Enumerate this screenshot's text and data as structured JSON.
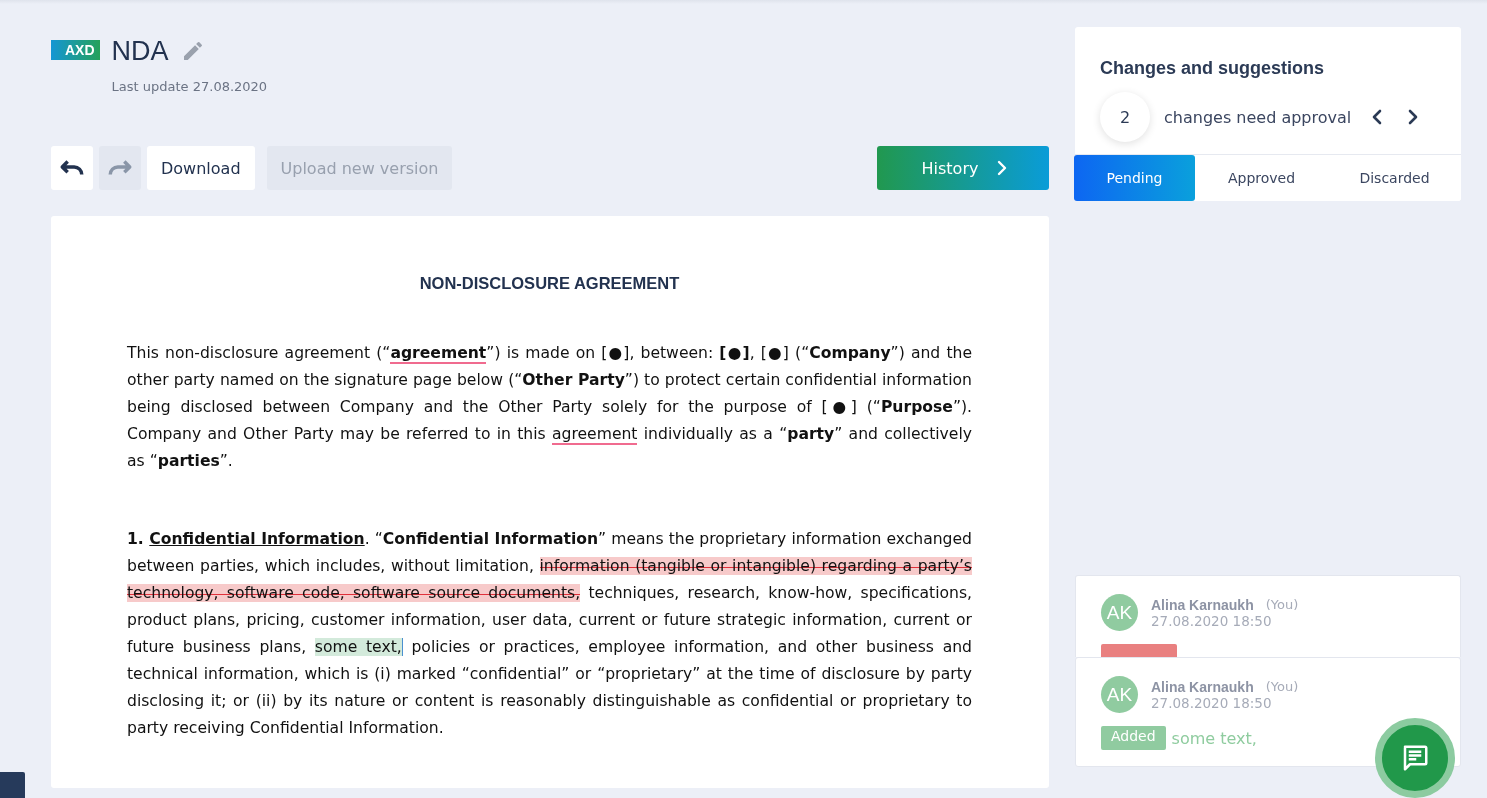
{
  "header": {
    "badge": "AXD",
    "title": "NDA",
    "last_update": "Last update 27.08.2020"
  },
  "toolbar": [
    {
      "kind": "undo",
      "disabled": false
    },
    {
      "kind": "redo",
      "disabled": true
    },
    {
      "kind": "text",
      "label": "Download",
      "disabled": false
    },
    {
      "kind": "text",
      "label": "Upload new version",
      "disabled": true
    }
  ],
  "history_button": {
    "label": "History"
  },
  "document": {
    "title": "NON-DISCLOSURE AGREEMENT",
    "paragraphs": [
      {
        "segments": [
          {
            "kind": "plain",
            "text": "This non-disclosure agreement (“"
          },
          {
            "kind": "bold-flagged",
            "text": "agreement"
          },
          {
            "kind": "plain",
            "text": "”) is made on [●], between: "
          },
          {
            "kind": "bold",
            "text": "[●]"
          },
          {
            "kind": "plain",
            "text": ", [●] (“"
          },
          {
            "kind": "bold",
            "text": "Company"
          },
          {
            "kind": "plain",
            "text": "”) and the other party named on the signature page below (“"
          },
          {
            "kind": "bold",
            "text": "Other Party"
          },
          {
            "kind": "plain",
            "text": "”) to protect certain confidential information being disclosed between Company and the Other Party solely for the purpose of [●] (“"
          },
          {
            "kind": "bold",
            "text": "Purpose"
          },
          {
            "kind": "plain",
            "text": "”). Company and Other Party may be referred to in this "
          },
          {
            "kind": "flagged",
            "text": "agreement"
          },
          {
            "kind": "plain",
            "text": " individually as a “"
          },
          {
            "kind": "bold",
            "text": "party"
          },
          {
            "kind": "plain",
            "text": "” and collectively as “"
          },
          {
            "kind": "bold",
            "text": "parties"
          },
          {
            "kind": "plain",
            "text": "”."
          }
        ]
      },
      {
        "segments": [
          {
            "kind": "bold",
            "text": "1. "
          },
          {
            "kind": "bold-underlined",
            "text": "Confidential Information"
          },
          {
            "kind": "plain",
            "text": ". “"
          },
          {
            "kind": "bold",
            "text": "Confidential Information"
          },
          {
            "kind": "plain",
            "text": "” means the proprietary information exchanged between parties, which includes, without limitation, "
          },
          {
            "kind": "deleted",
            "text": "information (tangible or intangible) regarding a party’s technology, software code, software source documents,"
          },
          {
            "kind": "plain",
            "text": " techniques, research, know-how, specifications, product plans, pricing, customer information, user data, current or future strategic information, current or future business plans, "
          },
          {
            "kind": "added",
            "text": "some text,"
          },
          {
            "kind": "plain",
            "text": " policies or practices, employee information, and other business and technical information, which is (i) marked “confidential” or “proprietary” at the time of disclosure by party disclosing it; or (ii) by its nature or content is reasonably distinguishable as confidential or proprietary to party receiving Confidential Information."
          }
        ]
      }
    ]
  },
  "changes_panel": {
    "title": "Changes and suggestions",
    "count": "2",
    "count_label": "changes need approval",
    "tabs": [
      {
        "label": "Pending",
        "selected": true
      },
      {
        "label": "Approved",
        "selected": false
      },
      {
        "label": "Discarded",
        "selected": false
      }
    ]
  },
  "comments": [
    {
      "initials": "AK",
      "author": "Alina Karnaukh",
      "you": "(You)",
      "time": "27.08.2020 18:50",
      "kind": "deleted",
      "covered": true
    },
    {
      "initials": "AK",
      "author": "Alina Karnaukh",
      "you": "(You)",
      "time": "27.08.2020 18:50",
      "kind": "added",
      "tag": "Added",
      "text": "some text,",
      "covered": false
    }
  ]
}
